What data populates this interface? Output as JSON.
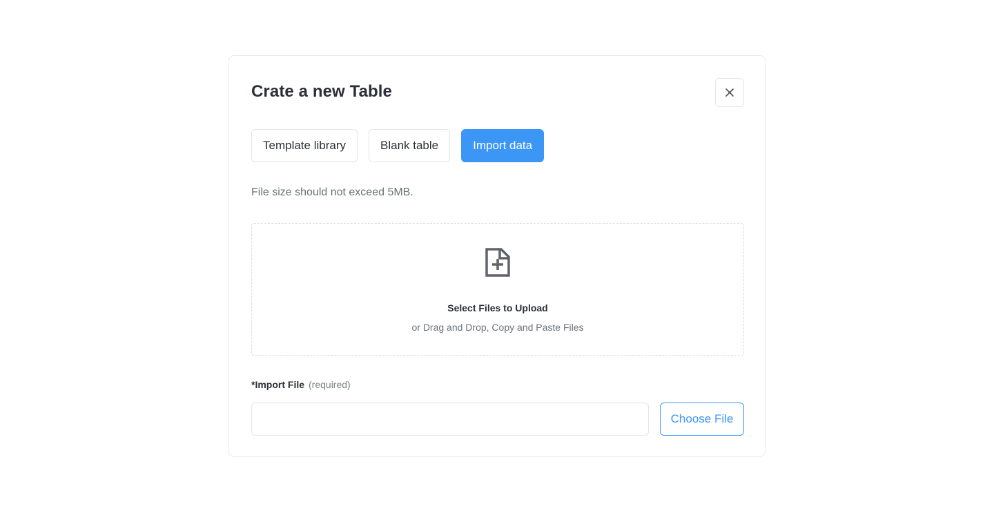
{
  "dialog": {
    "title": "Crate a new Table",
    "close_icon": "close-icon"
  },
  "tabs": [
    {
      "label": "Template library",
      "active": false
    },
    {
      "label": "Blank table",
      "active": false
    },
    {
      "label": "Import data",
      "active": true
    }
  ],
  "hint": "File size should not exceed 5MB.",
  "dropzone": {
    "icon": "file-plus-icon",
    "title": "Select Files to Upload",
    "subtitle": "or Drag and Drop, Copy and Paste Files"
  },
  "import_field": {
    "label": "*Import File",
    "note": "(required)",
    "value": "",
    "placeholder": "",
    "button_label": "Choose File"
  },
  "colors": {
    "accent": "#3b96f5",
    "text": "#2b2f36",
    "muted": "#6b7079",
    "border": "#e3e5e8"
  }
}
